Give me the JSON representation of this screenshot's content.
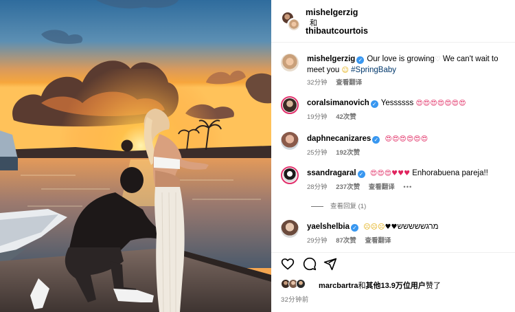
{
  "post": {
    "header": {
      "author": "mishelgerzig",
      "and": "和",
      "coauthor": "thibautcourtois"
    },
    "caption": {
      "username": "mishelgerzig",
      "text_before_heart": "Our love is growing",
      "text_after_heart": " We can't wait to meet you ",
      "hashtag": "#SpringBaby",
      "time": "32分钟",
      "translate": "查看翻译",
      "heart_icon": "white-heart-icon",
      "emoji_icon": "face-emoji-icon"
    },
    "comments": [
      {
        "username": "coralsimanovich",
        "text": "Yessssss",
        "emoji": [
          "heart-eyes",
          "heart-eyes",
          "heart-eyes",
          "heart-eyes",
          "heart-eyes",
          "heart-eyes",
          "heart-eyes"
        ],
        "time": "19分钟",
        "likes": "42次赞",
        "translate": ""
      },
      {
        "username": "daphnecanizares",
        "text": "",
        "emoji": [
          "heart-eyes",
          "heart-eyes",
          "heart-eyes",
          "heart-eyes",
          "heart-eyes",
          "heart-eyes"
        ],
        "time": "25分钟",
        "likes": "192次赞",
        "translate": ""
      },
      {
        "username": "ssandragaral",
        "text": "Enhorabuena pareja!!",
        "emoji": [
          "heart-eyes",
          "heart-eyes",
          "heart-eyes",
          "red-heart",
          "red-heart",
          "red-heart"
        ],
        "time": "28分钟",
        "likes": "237次赞",
        "translate": "查看翻译",
        "more": "•••"
      },
      {
        "username": "yaelshelbia",
        "text": "מרגששששש",
        "emoji": [
          "pleading-face",
          "pleading-face",
          "pleading-face",
          "black-heart",
          "black-heart"
        ],
        "time": "29分钟",
        "likes": "87次赞",
        "translate": "查看翻译"
      }
    ],
    "view_replies": "查看回复 (1)",
    "actions": {
      "like_icon": "heart-outline-icon",
      "comment_icon": "comment-bubble-icon",
      "share_icon": "paper-plane-icon"
    },
    "likes": {
      "first_user": "marcbartra",
      "joiner": "和",
      "others": "其他13.9万位用户",
      "suffix": "赞了"
    },
    "posted": "32分钟前"
  }
}
